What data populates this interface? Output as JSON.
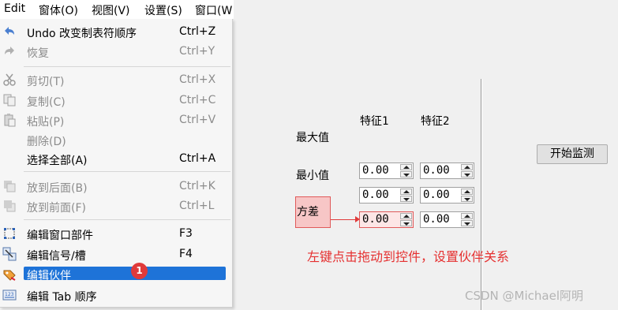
{
  "menubar": {
    "items": [
      "Edit",
      "窗体(O)",
      "视图(V)",
      "设置(S)",
      "窗口(W"
    ]
  },
  "menu": {
    "items": [
      {
        "label": "Undo 改变制表符顺序",
        "shortcut": "Ctrl+Z",
        "enabled": true,
        "icon": "undo-icon"
      },
      {
        "label": "恢复",
        "shortcut": "Ctrl+Y",
        "enabled": false,
        "icon": "redo-icon"
      },
      {
        "label": "剪切(T)",
        "shortcut": "Ctrl+X",
        "enabled": false,
        "icon": "scissors-icon"
      },
      {
        "label": "复制(C)",
        "shortcut": "Ctrl+C",
        "enabled": false,
        "icon": "copy-icon"
      },
      {
        "label": "粘贴(P)",
        "shortcut": "Ctrl+V",
        "enabled": false,
        "icon": "paste-icon"
      },
      {
        "label": "删除(D)",
        "shortcut": "",
        "enabled": false,
        "icon": ""
      },
      {
        "label": "选择全部(A)",
        "shortcut": "Ctrl+A",
        "enabled": true,
        "icon": ""
      },
      {
        "label": "放到后面(B)",
        "shortcut": "Ctrl+K",
        "enabled": false,
        "icon": "send-back-icon"
      },
      {
        "label": "放到前面(F)",
        "shortcut": "Ctrl+L",
        "enabled": false,
        "icon": "bring-front-icon"
      },
      {
        "label": "编辑窗口部件",
        "shortcut": "F3",
        "enabled": true,
        "icon": "edit-widgets-icon"
      },
      {
        "label": "编辑信号/槽",
        "shortcut": "F4",
        "enabled": true,
        "icon": "edit-signals-icon"
      },
      {
        "label": "编辑伙伴",
        "shortcut": "",
        "enabled": true,
        "selected": true,
        "icon": "edit-buddies-icon"
      },
      {
        "label": "编辑 Tab 顺序",
        "shortcut": "",
        "enabled": true,
        "icon": "tab-order-icon"
      }
    ],
    "badge": "1"
  },
  "form": {
    "col1": "特征1",
    "col2": "特征2",
    "max_label": "最大值",
    "min_label": "最小值",
    "variance_label": "方差",
    "spin_values": [
      "0.00",
      "0.00",
      "0.00",
      "0.00",
      "0.00",
      "0.00"
    ],
    "start_button": "开始监测",
    "instruction": "左键点击拖动到控件，设置伙伴关系"
  },
  "watermark": "CSDN @Michael阿明",
  "colors": {
    "highlight": "#1e73d8",
    "annotation": "#e53030"
  }
}
